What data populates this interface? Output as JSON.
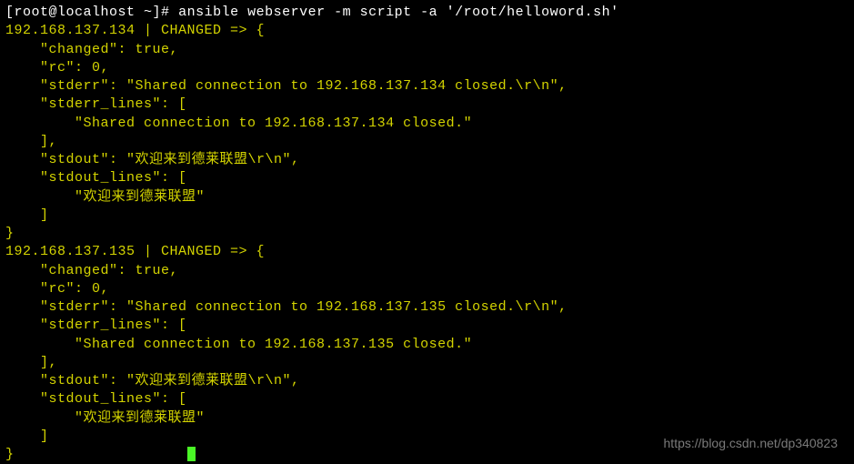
{
  "prompt": {
    "open_bracket": "[",
    "user_host": "root@localhost ~",
    "close_bracket": "]#",
    "command": " ansible webserver -m script -a '/root/helloword.sh'"
  },
  "hosts": [
    {
      "header": "192.168.137.134 | CHANGED => {",
      "lines": [
        "    \"changed\": true,",
        "    \"rc\": 0,",
        "    \"stderr\": \"Shared connection to 192.168.137.134 closed.\\r\\n\",",
        "    \"stderr_lines\": [",
        "        \"Shared connection to 192.168.137.134 closed.\"",
        "    ],",
        "    \"stdout\": \"欢迎来到德莱联盟\\r\\n\",",
        "    \"stdout_lines\": [",
        "        \"欢迎来到德莱联盟\"",
        "    ]",
        "}"
      ]
    },
    {
      "header": "192.168.137.135 | CHANGED => {",
      "lines": [
        "    \"changed\": true,",
        "    \"rc\": 0,",
        "    \"stderr\": \"Shared connection to 192.168.137.135 closed.\\r\\n\",",
        "    \"stderr_lines\": [",
        "        \"Shared connection to 192.168.137.135 closed.\"",
        "    ],",
        "    \"stdout\": \"欢迎来到德莱联盟\\r\\n\",",
        "    \"stdout_lines\": [",
        "        \"欢迎来到德莱联盟\"",
        "    ]",
        "}"
      ]
    }
  ],
  "watermark": "https://blog.csdn.net/dp340823"
}
